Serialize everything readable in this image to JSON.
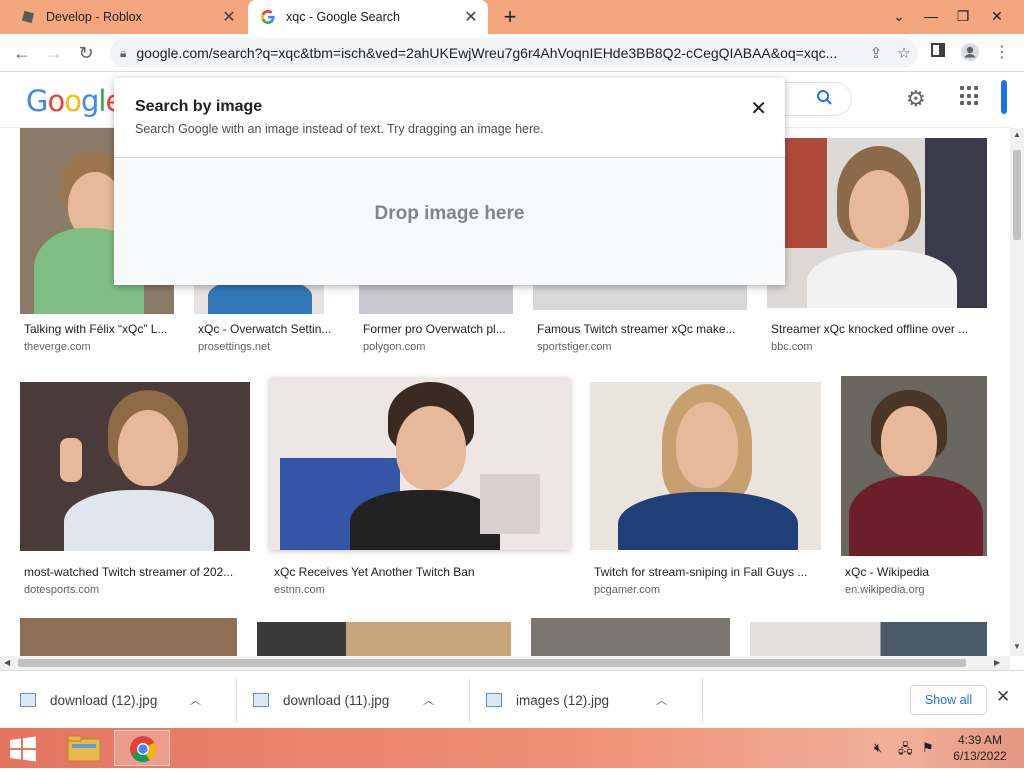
{
  "browser": {
    "tabs": [
      {
        "title": "Develop - Roblox",
        "active": false
      },
      {
        "title": "xqc - Google Search",
        "active": true
      }
    ],
    "address": "google.com/search?q=xqc&tbm=isch&ved=2ahUKEwjWreu7g6r4AhVoqnIEHde3BB8Q2-cCegQIABAA&oq=xqc..."
  },
  "google": {
    "logo_letters": [
      {
        "ch": "G",
        "color": "#4285F4"
      },
      {
        "ch": "o",
        "color": "#EA4335"
      },
      {
        "ch": "o",
        "color": "#FBBC05"
      },
      {
        "ch": "g",
        "color": "#4285F4"
      },
      {
        "ch": "l",
        "color": "#34A853"
      },
      {
        "ch": "e",
        "color": "#EA4335"
      }
    ]
  },
  "modal": {
    "title": "Search by image",
    "subtitle": "Search Google with an image instead of text. Try dragging an image here.",
    "drop_label": "Drop image here"
  },
  "results": [
    {
      "caption": "Talking with Félix “xQc” L...",
      "source": "theverge.com"
    },
    {
      "caption": "xQc - Overwatch Settin...",
      "source": "prosettings.net"
    },
    {
      "caption": "Former pro Overwatch pl...",
      "source": "polygon.com"
    },
    {
      "caption": "Famous Twitch streamer xQc make...",
      "source": "sportstiger.com"
    },
    {
      "caption": "Streamer xQc knocked offline over ...",
      "source": "bbc.com"
    },
    {
      "caption": "most-watched Twitch streamer of 202...",
      "source": "dotesports.com"
    },
    {
      "caption": "xQc Receives Yet Another Twitch Ban",
      "source": "estnn.com"
    },
    {
      "caption": "Twitch for stream-sniping in Fall Guys ...",
      "source": "pcgamer.com"
    },
    {
      "caption": "xQc - Wikipedia",
      "source": "en.wikipedia.org"
    }
  ],
  "downloads": {
    "items": [
      {
        "name": "download (12).jpg"
      },
      {
        "name": "download (11).jpg"
      },
      {
        "name": "images (12).jpg"
      }
    ],
    "show_all": "Show all"
  },
  "taskbar": {
    "time": "4:39 AM",
    "date": "6/13/2022"
  },
  "colors": {
    "tab_strip": "#f4a77f",
    "accent": "#1a73e8",
    "taskbar": "#ef8f73"
  }
}
